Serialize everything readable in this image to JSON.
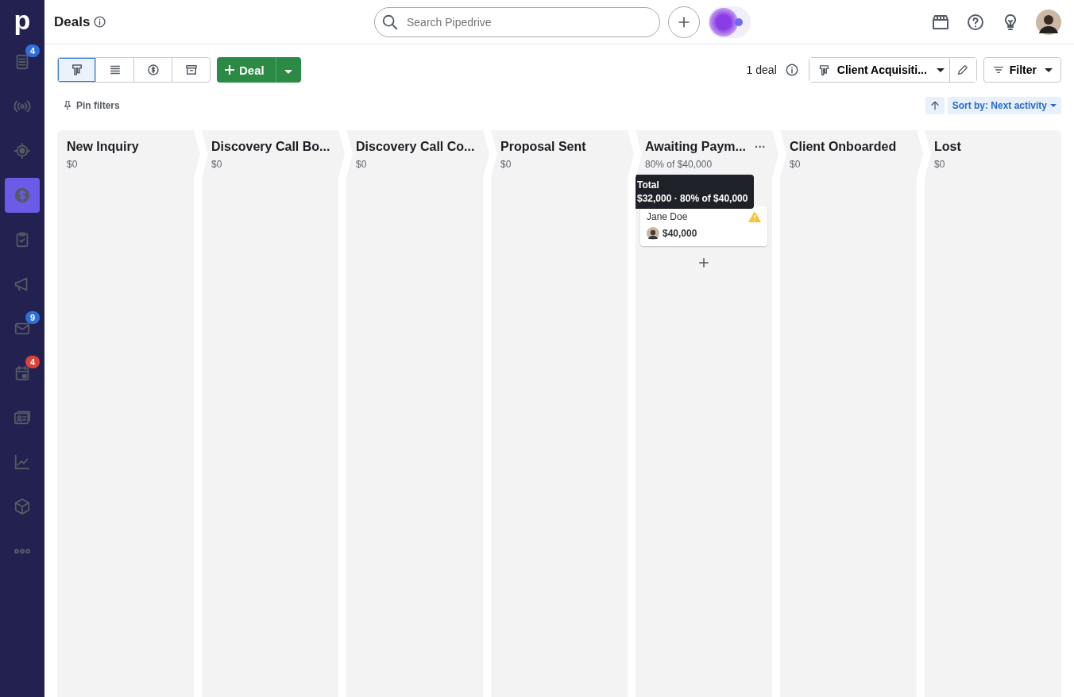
{
  "sidebar": {
    "logo": "p",
    "items": [
      {
        "selected": false,
        "badge": "4",
        "color": "#2f6fdc"
      },
      {
        "selected": false
      },
      {
        "selected": false
      },
      {
        "selected": true
      },
      {
        "selected": false
      },
      {
        "selected": false
      },
      {
        "selected": false,
        "badge": "9",
        "color": "#2f6fdc"
      },
      {
        "selected": false,
        "badge": "4",
        "color": "#d9423a"
      },
      {
        "selected": false
      },
      {
        "selected": false
      },
      {
        "selected": false
      },
      {
        "selected": false
      }
    ]
  },
  "header": {
    "title": "Deals",
    "search": {
      "placeholder": "Search Pipedrive"
    }
  },
  "toolbar": {
    "views": [
      {
        "selected": true
      },
      {
        "selected": false
      },
      {
        "selected": false
      },
      {
        "selected": false
      }
    ],
    "add_button": "Deal",
    "count": "1 deal",
    "pipeline": "Client Acquisiti...",
    "filter": "Filter",
    "pin_filters": "Pin filters",
    "sort": "Sort by: Next activity"
  },
  "stages": [
    {
      "name": "New Inquiry",
      "total": "$0"
    },
    {
      "name": "Discovery Call Bo...",
      "total": "$0"
    },
    {
      "name": "Discovery Call Co...",
      "total": "$0"
    },
    {
      "name": "Proposal Sent",
      "total": "$0"
    },
    {
      "name": "Awaiting Paym...",
      "total": "80% of $40,000",
      "menu_label": "···",
      "add": true,
      "tooltip": {
        "title": "Total",
        "text": "$32,000 · 80% of $40,000"
      },
      "deals": [
        {
          "contact": "Jane Doe",
          "value": "$40,000",
          "warning": true
        }
      ]
    },
    {
      "name": "Client Onboarded",
      "total": "$0"
    },
    {
      "name": "Lost",
      "total": "$0"
    }
  ]
}
